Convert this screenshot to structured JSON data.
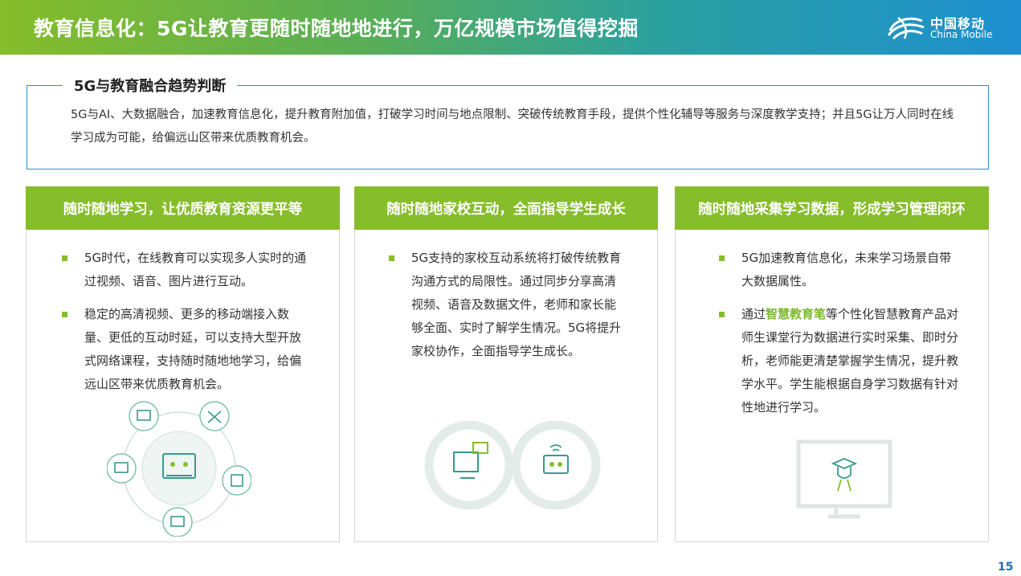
{
  "header": {
    "title": "教育信息化：5G让教育更随时随地地进行，万亿规模市场值得挖掘",
    "logo_cn": "中国移动",
    "logo_en": "China Mobile"
  },
  "judgement": {
    "title": "5G与教育融合趋势判断",
    "text": "5G与AI、大数据融合，加速教育信息化，提升教育附加值，打破学习时间与地点限制、突破传统教育手段，提供个性化辅导等服务与深度教学支持；并且5G让万人同时在线学习成为可能，给偏远山区带来优质教育机会。"
  },
  "cards": [
    {
      "title": "随时随地学习，让优质教育资源更平等",
      "bullets": [
        {
          "text": "5G时代，在线教育可以实现多人实时的通过视频、语音、图片进行互动。"
        },
        {
          "text": "稳定的高清视频、更多的移动端接入数量、更低的互动时延，可以支持大型开放式网络课程，支持随时随地地学习，给偏远山区带来优质教育机会。"
        }
      ]
    },
    {
      "title": "随时随地家校互动，全面指导学生成长",
      "bullets": [
        {
          "text": "5G支持的家校互动系统将打破传统教育沟通方式的局限性。通过同步分享高清视频、语音及数据文件，老师和家长能够全面、实时了解学生情况。5G将提升家校协作，全面指导学生成长。"
        }
      ]
    },
    {
      "title": "随时随地采集学习数据，形成学习管理闭环",
      "bullets": [
        {
          "text": "5G加速教育信息化，未来学习场景自带大数据属性。"
        },
        {
          "pre": "通过",
          "highlight": "智慧教育笔",
          "post": "等个性化智慧教育产品对师生课堂行为数据进行实时采集、即时分析，老师能更清楚掌握学生情况，提升教学水平。学生能根据自身学习数据有针对性地进行学习。"
        }
      ]
    }
  ],
  "page_number": "15",
  "colors": {
    "accent_green": "#86bd2a",
    "frame_blue": "#2b8fc9",
    "illustration_teal": "#3a9a8a"
  }
}
